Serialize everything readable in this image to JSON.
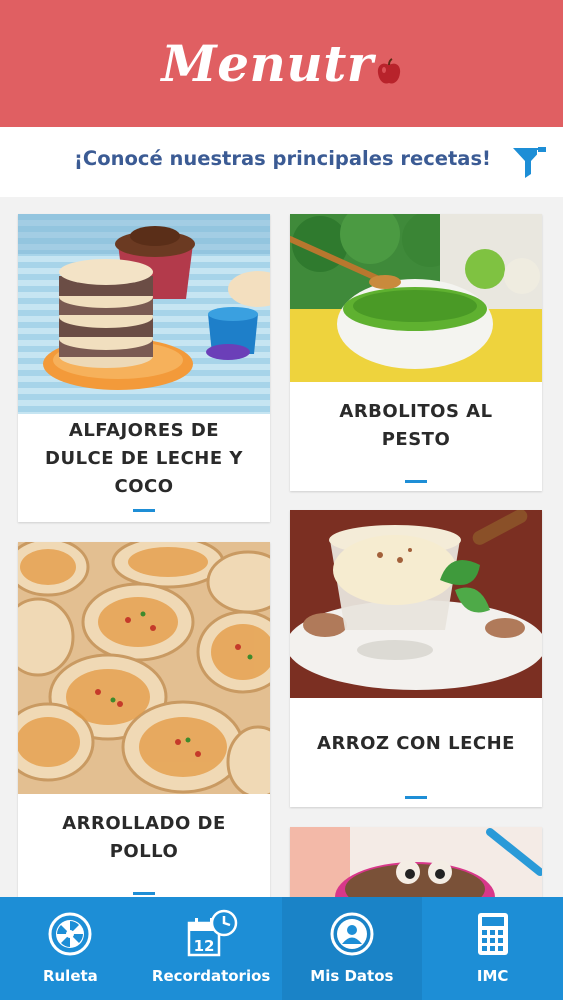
{
  "app": {
    "brand": "Menutr"
  },
  "colors": {
    "header": "#e05f62",
    "accent": "#1d8ed6",
    "title_text": "#3b5b94",
    "nav": "#1d8ed6"
  },
  "subheader": {
    "title": "¡Conocé nuestras principales recetas!",
    "filter_icon": "funnel-icon"
  },
  "recipes": [
    {
      "title_line1": "ALFAJORES DE",
      "title_line2": "DULCE DE LECHE Y",
      "title_line3": "COCO"
    },
    {
      "title_line1": "ARBOLITOS  AL",
      "title_line2": "PESTO"
    },
    {
      "title_line1": "ARROLLADO DE",
      "title_line2": "POLLO"
    },
    {
      "title_line1": "ARROZ CON LECHE"
    },
    {
      "title_line1": ""
    }
  ],
  "nav": {
    "items": [
      {
        "label": "Ruleta",
        "icon": "roulette-wheel-icon"
      },
      {
        "label": "Recordatorios",
        "icon": "calendar-clock-icon"
      },
      {
        "label": "Mis Datos",
        "icon": "user-profile-icon"
      },
      {
        "label": "IMC",
        "icon": "calculator-icon"
      }
    ]
  }
}
